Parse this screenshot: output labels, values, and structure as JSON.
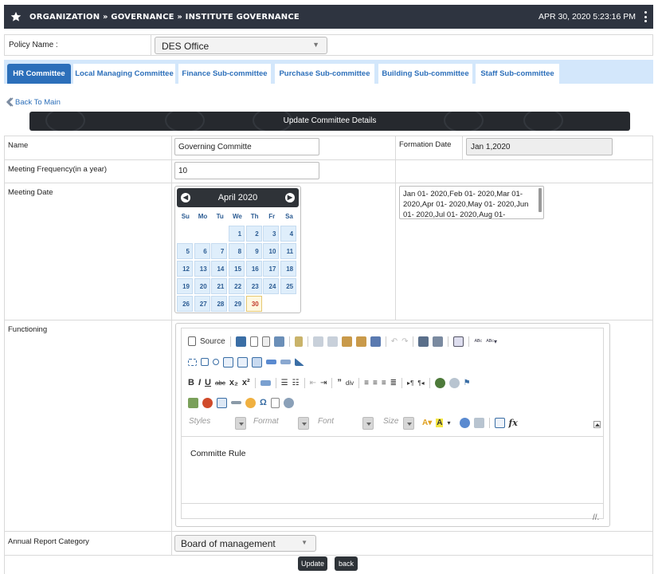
{
  "topbar": {
    "breadcrumb": "ORGANIZATION » GOVERNANCE » INSTITUTE GOVERNANCE",
    "datetime": "APR 30, 2020  5:23:16 PM"
  },
  "policy": {
    "label": "Policy Name :",
    "value": "DES Office"
  },
  "tabs": [
    {
      "label": "HR Committee"
    },
    {
      "label": "Local Managing Committee"
    },
    {
      "label": "Finance Sub-committee"
    },
    {
      "label": "Purchase Sub-committee"
    },
    {
      "label": "Building Sub-committee"
    },
    {
      "label": "Staff Sub-committee"
    }
  ],
  "back_label": "Back To Main",
  "section_title": "Update Committee Details",
  "form": {
    "name_label": "Name",
    "name_value": "Governing Committe",
    "formation_label": "Formation Date",
    "formation_value": "Jan 1,2020",
    "frequency_label": "Meeting Frequency(in a year)",
    "frequency_value": "10",
    "meeting_label": "Meeting Date",
    "meeting_dates_text": "Jan 01- 2020,Feb 01- 2020,Mar 01- 2020,Apr 01- 2020,May 01- 2020,Jun 01- 2020,Jul 01- 2020,Aug 01-",
    "functioning_label": "Functioning",
    "annual_label": "Annual Report Category",
    "annual_value": "Board of management"
  },
  "calendar": {
    "month_title": "April 2020",
    "weekdays": [
      "Su",
      "Mo",
      "Tu",
      "We",
      "Th",
      "Fr",
      "Sa"
    ],
    "today": 30,
    "days": [
      "",
      "",
      "",
      "1",
      "2",
      "3",
      "4",
      "5",
      "6",
      "7",
      "8",
      "9",
      "10",
      "11",
      "12",
      "13",
      "14",
      "15",
      "16",
      "17",
      "18",
      "19",
      "20",
      "21",
      "22",
      "23",
      "24",
      "25",
      "26",
      "27",
      "28",
      "29",
      "30",
      "",
      ""
    ]
  },
  "editor": {
    "source_label": "Source",
    "styles_label": "Styles",
    "format_label": "Format",
    "font_label": "Font",
    "size_label": "Size",
    "content": "Committe Rule"
  },
  "buttons": {
    "update": "Update",
    "back": "back"
  }
}
